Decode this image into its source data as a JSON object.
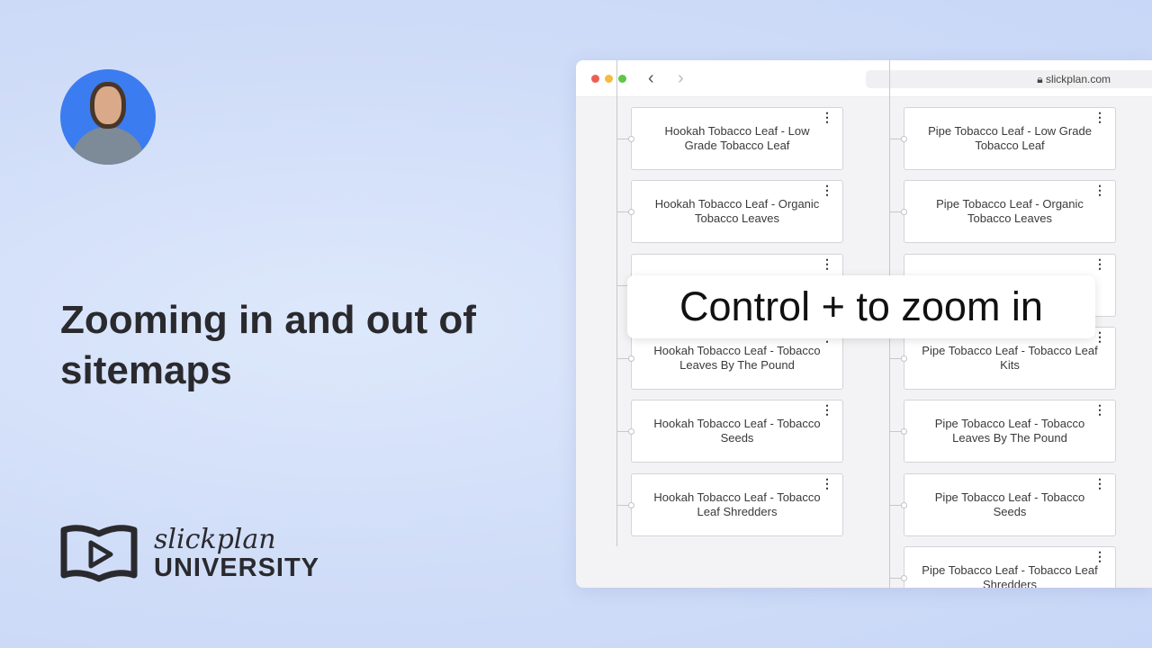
{
  "video": {
    "title": "Zooming in and out of sitemaps",
    "caption": "Control + to zoom in"
  },
  "brand": {
    "script": "slickplan",
    "university": "UNIVERSITY"
  },
  "browser": {
    "url": "slickplan.com",
    "window_colors": [
      "#ec5f57",
      "#f4bb3f",
      "#5fc648"
    ]
  },
  "sitemap": {
    "left": [
      "Hookah Tobacco Leaf - Low Grade Tobacco Leaf",
      "Hookah Tobacco Leaf - Organic Tobacco Leaves",
      "",
      "Hookah Tobacco Leaf - Tobacco Leaves By The Pound",
      "Hookah Tobacco Leaf - Tobacco Seeds",
      "Hookah Tobacco Leaf - Tobacco Leaf Shredders"
    ],
    "right": [
      "Pipe Tobacco Leaf - Low Grade Tobacco Leaf",
      "Pipe Tobacco Leaf - Organic Tobacco Leaves",
      "",
      "Pipe Tobacco Leaf - Tobacco Leaf Kits",
      "Pipe Tobacco Leaf - Tobacco Leaves By The Pound",
      "Pipe Tobacco Leaf - Tobacco Seeds",
      "Pipe Tobacco Leaf - Tobacco Leaf Shredders"
    ]
  }
}
